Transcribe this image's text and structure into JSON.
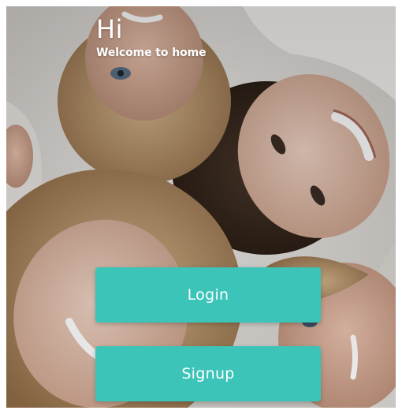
{
  "greeting": {
    "title": "Hi",
    "subtitle": "Welcome to home"
  },
  "actions": {
    "login_label": "Login",
    "signup_label": "Signup"
  },
  "colors": {
    "button_background": "#3cc4b8",
    "button_text": "#ffffff",
    "greeting_text": "#ffffff"
  }
}
